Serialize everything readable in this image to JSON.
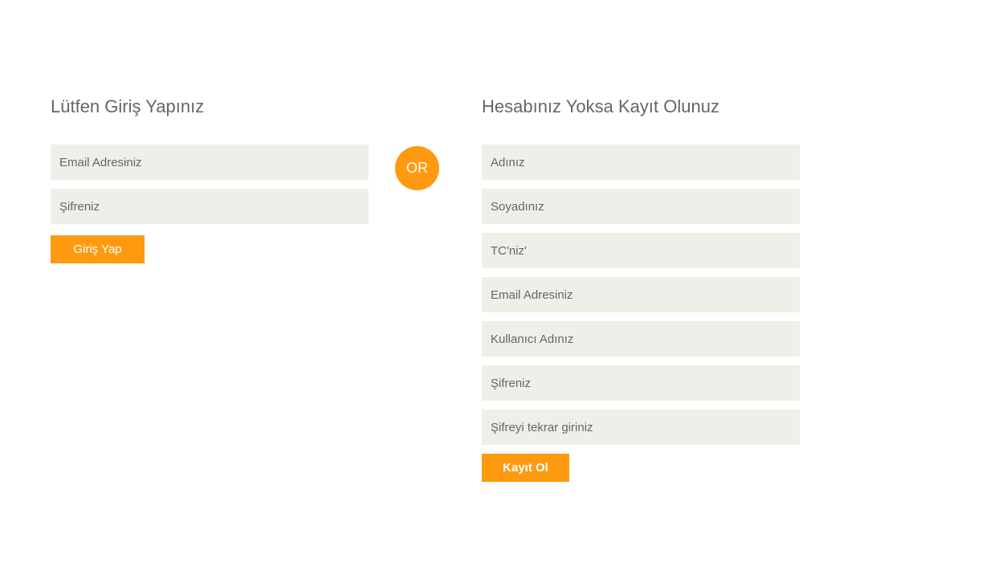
{
  "login": {
    "title": "Lütfen Giriş Yapınız",
    "email_placeholder": "Email Adresiniz",
    "password_placeholder": "Şifreniz",
    "submit_label": "Giriş Yap"
  },
  "divider": {
    "label": "OR"
  },
  "register": {
    "title": "Hesabınız Yoksa Kayıt Olunuz",
    "fields": [
      "Adınız",
      "Soyadınız",
      "TC'niz'",
      "Email Adresiniz",
      "Kullanıcı Adınız",
      "Şifreniz",
      "Şifreyi tekrar giriniz"
    ],
    "submit_label": "Kayıt Ol"
  },
  "colors": {
    "accent": "#ff9a10",
    "field_background": "#efeee8",
    "heading_text": "#666666"
  }
}
